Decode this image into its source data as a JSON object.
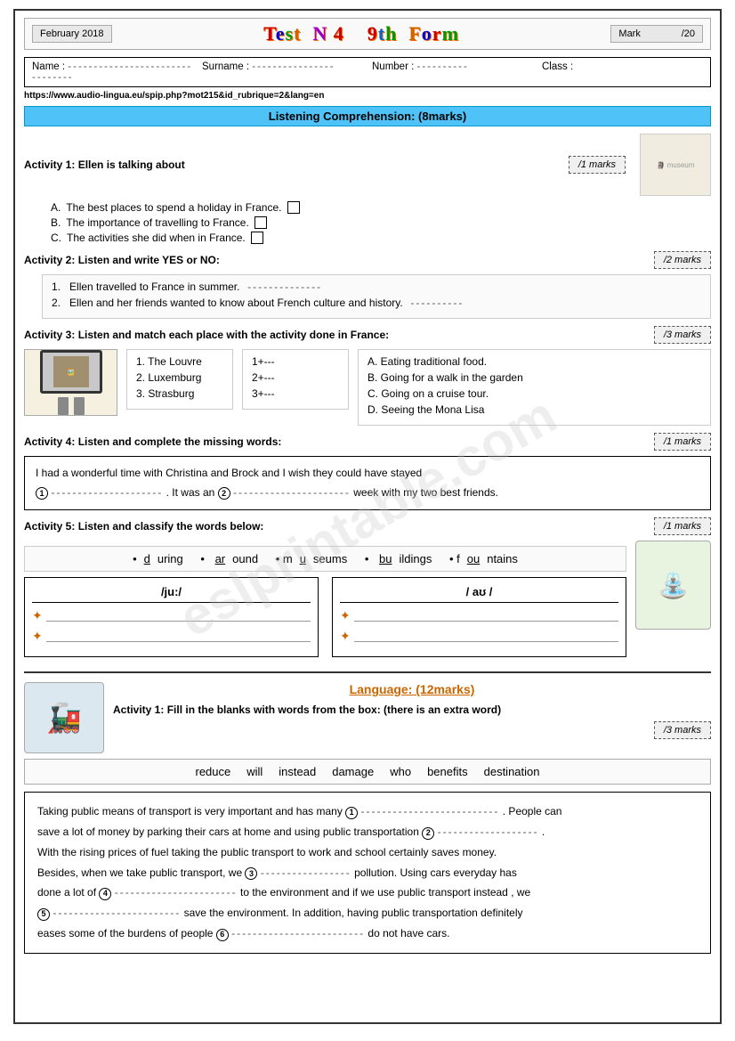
{
  "header": {
    "date": "February 2018",
    "title": "Test N 4  9th Form",
    "mark_label": "Mark",
    "mark_score": "/20"
  },
  "student_info": {
    "name_label": "Name :",
    "name_dashes": "--------------------------------",
    "surname_label": "Surname :",
    "surname_dashes": "----------------",
    "number_label": "Number :",
    "number_dashes": "----------",
    "class_label": "Class :"
  },
  "url": "https://www.audio-lingua.eu/spip.php?mot215&id_rubrique=2&lang=en",
  "listening": {
    "section_title": "Listening Comprehension: (8marks)",
    "activity1": {
      "title": "Activity 1:",
      "description": "Ellen is talking about",
      "marks": "/1 marks",
      "options": [
        "The best places to spend a holiday in France.",
        "The importance of travelling to France.",
        "The activities she did when in France."
      ]
    },
    "activity2": {
      "title": "Activity 2:",
      "description": "Listen and write YES or NO:",
      "marks": "/2 marks",
      "items": [
        "Ellen travelled to France in summer.",
        "Ellen and her friends wanted to know about French culture and history."
      ]
    },
    "activity3": {
      "title": "Activity 3:",
      "description": "Listen and match each place with the activity  done in France:",
      "marks": "/3 marks",
      "places": [
        "1.   The Louvre",
        "2.   Luxemburg",
        "3.   Strasburg"
      ],
      "arrows": [
        "1+---",
        "2+---",
        "3+---"
      ],
      "activities": [
        "A.   Eating traditional food.",
        "B.   Going for a walk in the garden",
        "C.   Going on a cruise tour.",
        "D.   Seeing the Mona Lisa"
      ]
    },
    "activity4": {
      "title": "Activity 4:",
      "description": "Listen and complete the missing words:",
      "marks": "/1 marks",
      "text": "I had a wonderful time with Christina and Brock and I wish they could have stayed",
      "blank1_num": "1",
      "blank1": "--------------------",
      "text2": ". It was an",
      "blank2_num": "2",
      "blank2": "--------------------",
      "text3": "week with my two best friends."
    },
    "activity5": {
      "title": "Activity 5:",
      "description": "Listen and classify the words below:",
      "marks": "/1 marks",
      "words": [
        "•during",
        "• around",
        "• museums",
        "• buildings",
        "• fountains"
      ],
      "phoneme1": "/ju:/",
      "phoneme2": "/ aʊ /",
      "phoneme1_lines": 2,
      "phoneme2_lines": 2
    }
  },
  "language": {
    "section_title": "Language: (12marks)",
    "activity1": {
      "title": "Activity 1:",
      "description": "Fill in the blanks with words from the box: (there is an extra word)",
      "marks": "/3 marks",
      "word_bank": [
        "reduce",
        "will",
        "instead",
        "damage",
        "who",
        "benefits",
        "destination"
      ],
      "passage": "Taking public means of transport is very important and has many",
      "blank1": "1",
      "passage2": ". People can save a lot of money by parking their cars at home and using public transportation",
      "blank2": "2",
      "passage3": ". With the rising prices of fuel taking the public transport to work and school certainly saves money. Besides, when we take public transport, we",
      "blank3": "3",
      "passage4": "pollution. Using cars everyday has done a lot of",
      "blank4": "4",
      "passage5": "to the environment and if we use public transport instead, we",
      "blank5": "5",
      "passage6": "save the environment. In addition, having public transportation definitely eases some of the burdens of people",
      "blank6": "6",
      "passage7": "do not have cars."
    }
  }
}
